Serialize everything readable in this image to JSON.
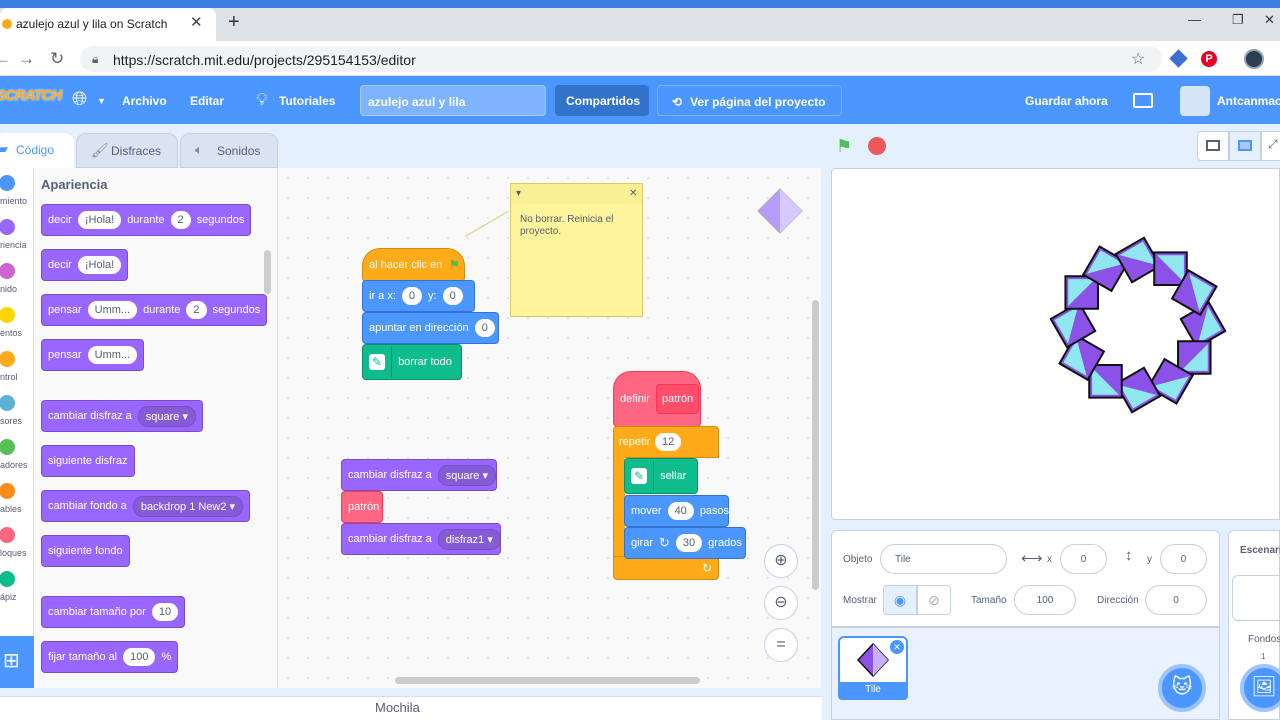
{
  "browser": {
    "tab_title": "azulejo azul y lila on Scratch",
    "tab_close": "✕",
    "new_tab": "+",
    "url": "https://scratch.mit.edu/projects/295154153/editor",
    "minimize": "—",
    "restore": "❐",
    "close": "✕"
  },
  "menu": {
    "logo": "SCRATCH",
    "file": "Archivo",
    "edit": "Editar",
    "tutorials": "Tutoriales",
    "project_title": "azulejo azul y lila",
    "share": "Compartidos",
    "see_project_page": "Ver página del proyecto",
    "save_now": "Guardar ahora",
    "username": "Antcanmac"
  },
  "tabs": {
    "code": "Código",
    "costumes": "Disfraces",
    "sounds": "Sonidos"
  },
  "categories": [
    {
      "label": "miento",
      "color": "#4c97ff"
    },
    {
      "label": "riencia",
      "color": "#9966ff"
    },
    {
      "label": "nido",
      "color": "#cf63cf"
    },
    {
      "label": "entos",
      "color": "#ffd500"
    },
    {
      "label": "ntrol",
      "color": "#ffab19"
    },
    {
      "label": "sores",
      "color": "#5cb1d6"
    },
    {
      "label": "adores",
      "color": "#59c059"
    },
    {
      "label": "ables",
      "color": "#ff8c1a"
    },
    {
      "label": "loques",
      "color": "#ff6680"
    },
    {
      "label": "ápiz",
      "color": "#0fbd8c"
    }
  ],
  "palette": {
    "title": "Apariencia",
    "say_for": {
      "say": "decir",
      "msg": "¡Hola!",
      "for": "durante",
      "secs": "2",
      "unit": "segundos"
    },
    "say": {
      "say": "decir",
      "msg": "¡Hola!"
    },
    "think_for": {
      "think": "pensar",
      "msg": "Umm...",
      "for": "durante",
      "secs": "2",
      "unit": "segundos"
    },
    "think": {
      "think": "pensar",
      "msg": "Umm..."
    },
    "switch_costume": {
      "label": "cambiar disfraz a",
      "value": "square"
    },
    "next_costume": "siguiente disfraz",
    "switch_backdrop": {
      "label": "cambiar fondo a",
      "value": "backdrop 1 New2"
    },
    "next_backdrop": "siguiente fondo",
    "change_size": {
      "label": "cambiar tamaño por",
      "value": "10"
    },
    "set_size": {
      "label": "fijar tamaño al",
      "value": "100",
      "unit": "%"
    }
  },
  "script1": {
    "hat": "al hacer clic en",
    "goto": {
      "label": "ir a x:",
      "x": "0",
      "ylabel": "y:",
      "y": "0"
    },
    "point": {
      "label": "apuntar en dirección",
      "value": "0"
    },
    "erase": "borrar todo"
  },
  "script2": {
    "define": "definir",
    "name": "patrón",
    "repeat": {
      "label": "repetir",
      "value": "12"
    },
    "stamp": "sellar",
    "move": {
      "label": "mover",
      "value": "40",
      "unit": "pasos"
    },
    "turn": {
      "label": "girar",
      "value": "30",
      "unit": "grados"
    },
    "loop_arrow": "↻"
  },
  "script3": {
    "switch1": {
      "label": "cambiar disfraz a",
      "value": "square"
    },
    "call": "patrón",
    "switch2": {
      "label": "cambiar disfraz a",
      "value": "disfraz1"
    }
  },
  "note": {
    "text": "No borrar. Reinicia el proyecto.",
    "collapse": "▾",
    "close": "✕"
  },
  "backpack": "Mochila",
  "sprite_info": {
    "sprite_label": "Objeto",
    "sprite_name": "Tile",
    "x_label": "x",
    "x": "0",
    "y_label": "y",
    "y": "0",
    "show_label": "Mostrar",
    "size_label": "Tamaño",
    "size": "100",
    "direction_label": "Dirección",
    "direction": "0"
  },
  "sprite_list": {
    "tile_name": "Tile"
  },
  "backdrop_pane": {
    "label": "Escenari",
    "fondos": "Fondos",
    "count": "1"
  },
  "colors": {
    "accent": "#4c97ff",
    "looks": "#9966ff",
    "motion": "#4c97ff",
    "control": "#ffab19",
    "pen": "#0fbd8c",
    "myblocks": "#ff6680"
  }
}
